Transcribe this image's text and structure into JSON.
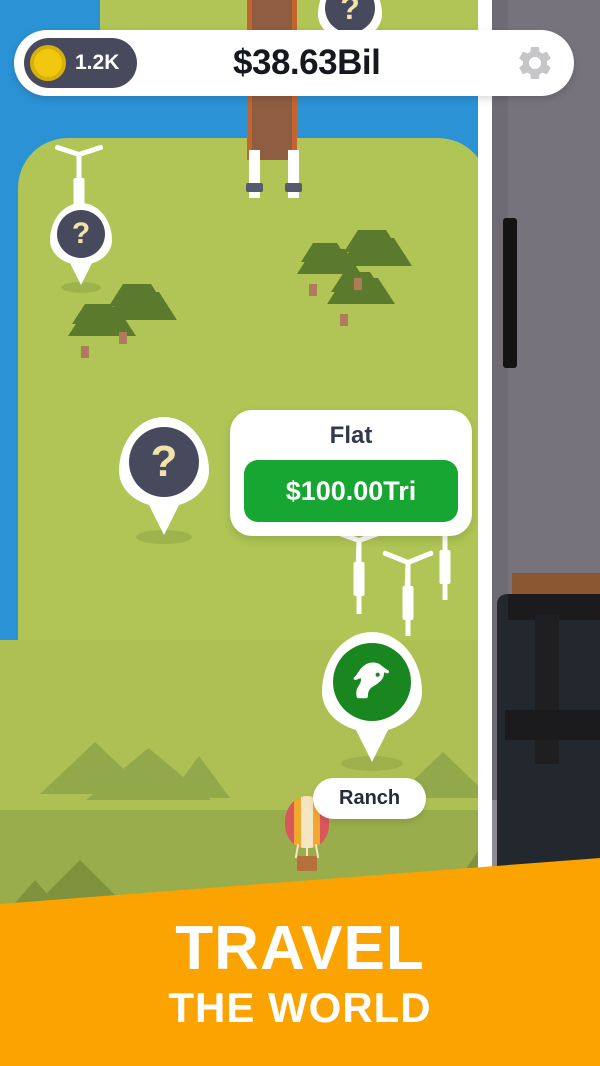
{
  "app": {
    "screen_title": "Travel the World map screen"
  },
  "hud": {
    "coin_icon": "gold-coin-icon",
    "coin_count": "1.2K",
    "money": "$38.63Bil",
    "settings_icon": "gear-icon"
  },
  "map": {
    "pins": [
      {
        "id": "pin-unknown-north",
        "icon": "question-mark-icon",
        "glyph": "?",
        "label": ""
      },
      {
        "id": "pin-unknown-center",
        "icon": "question-mark-icon",
        "glyph": "?",
        "label": ""
      },
      {
        "id": "pin-unknown-top",
        "icon": "question-mark-icon",
        "glyph": "?",
        "label": ""
      },
      {
        "id": "pin-ranch",
        "icon": "horse-head-icon",
        "glyph": "",
        "label": "Ranch"
      }
    ],
    "ranch_label": "Ranch",
    "scenery": {
      "balloon": "hot-air-balloon",
      "turbines": 4,
      "trees": 6,
      "hills": 7
    }
  },
  "info_card": {
    "title": "Flat",
    "price": "$100.00Tri"
  },
  "banner": {
    "line1": "TRAVEL",
    "line2": "THE WORLD"
  },
  "colors": {
    "land": "#b0c555",
    "water": "#2b92d5",
    "orange": "#fba300",
    "green_cta": "#16a631",
    "pin_dark": "#474a5d",
    "question_yellow": "#efe3a8",
    "coin": "#f2c80f",
    "ranch_green": "#19861f",
    "wall": "#6e6b75"
  }
}
